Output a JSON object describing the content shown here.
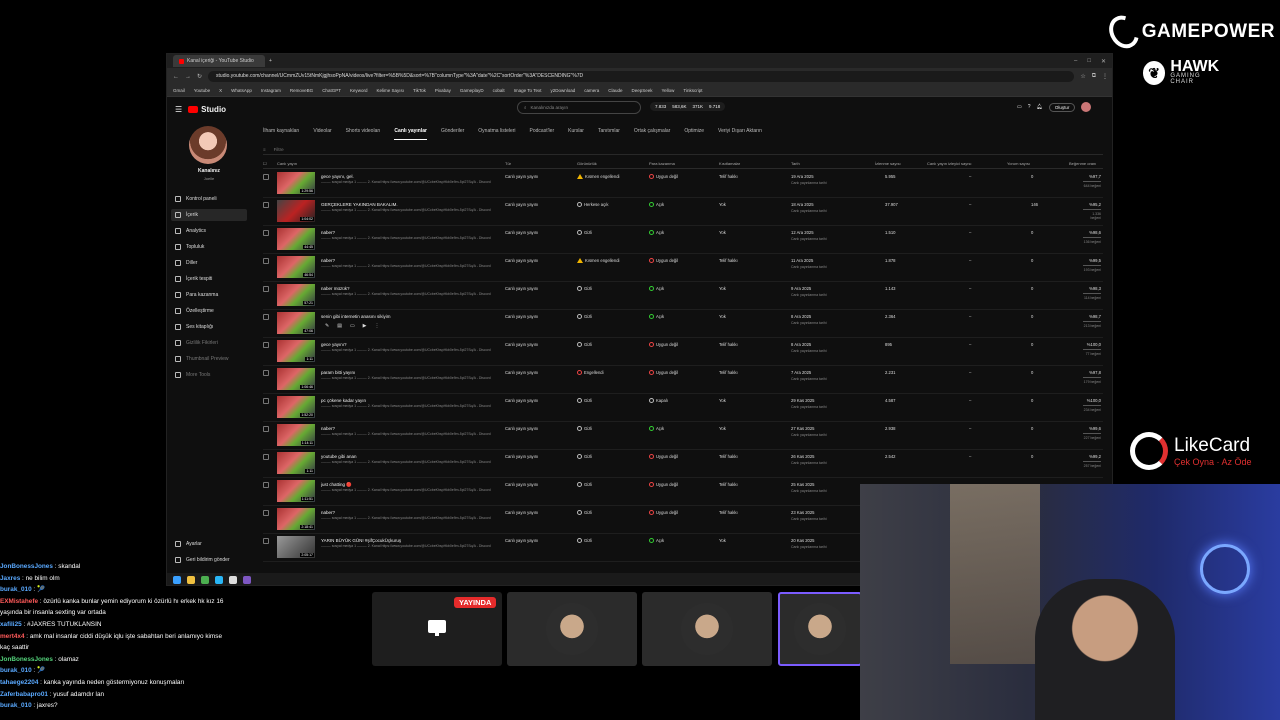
{
  "overlay": {
    "gamepower": "GAMEPOWER",
    "hawk": "HAWK",
    "hawk_sub": "GAMING CHAIR",
    "likecard": "LikeCard",
    "likecard_sub": "Çek Oyna · Az Öde"
  },
  "browser": {
    "tab_title": "Kanal içeriği - YouTube Studio",
    "url": "studio.youtube.com/channel/UCmmZUv15tNmKjgjhsoPpNA/videos/live?filter=%5B%5D&sort=%7B\"columnType\"%3A\"date\"%2C\"sortOrder\"%3A\"DESCENDING\"%7D",
    "bookmarks": [
      "Gmail",
      "Youtube",
      "X",
      "WhatsApp",
      "Instagram",
      "RemoveBG",
      "ChatGPT",
      "Keyword",
      "Kelime Sayısı",
      "TikTok",
      "Pixabay",
      "GameplayD",
      "cobalt",
      "Image To Text",
      "y2Download",
      "camera",
      "Claude",
      "DeepSeek",
      "Yellow",
      "Tinkscript"
    ]
  },
  "header": {
    "logo": "Studio",
    "search_placeholder": "Kanalınızda arayın",
    "stats": [
      "7.833",
      "583,6K",
      "371K",
      "9.718"
    ],
    "create": "Oluştur"
  },
  "sidebar": {
    "channel_name": "Kanalınız",
    "channel_sub": "Joelle",
    "items": [
      "Kontrol paneli",
      "İçerik",
      "Analytics",
      "Topluluk",
      "Diller",
      "İçerik tespiti",
      "Para kazanma",
      "Özelleştirme",
      "Ses kitaplığı",
      "Gizlilik Fikirleri",
      "Thumbnail Preview",
      "More Tools"
    ],
    "bottom": [
      "Ayarlar",
      "Geri bildirim gönder"
    ]
  },
  "tabs": [
    "İlham kaynakları",
    "Videolar",
    "Shorts videoları",
    "Canlı yayınlar",
    "Gönderiler",
    "Oynatma listeleri",
    "Podcast'ler",
    "Kurslar",
    "Tanıtımlar",
    "Ortak çalışmalar",
    "Optimize",
    "Veriyi Dışarı Aktarın"
  ],
  "filter_label": "Filtre",
  "columns": [
    "Canlı yayın",
    "Tür",
    "Görünürlük",
    "Para kazanma",
    "Kısıtlamalar",
    "Tarih",
    "İzlenme sayısı",
    "Canlı yayın izleyici sayısı",
    "Yorum sayısı",
    "Beğenme oranı"
  ],
  "rows": [
    {
      "title": "gece yayını, gel.",
      "dur": "1:29:56",
      "type": "Canlı yayın yayını",
      "vis": "Kısmen engellendi",
      "vis_icon": "warn",
      "money": "Uygun değil",
      "money_icon": "red",
      "restr": "Telif hakkı",
      "date": "19 Ara 2025",
      "date_sub": "Canlı yayınlanma tarihi",
      "views": "5.955",
      "live": "–",
      "comments": "0",
      "pct": "%97,7",
      "likes": "644 beğeni"
    },
    {
      "title": "GERÇEKLERE YAKINDAN BAKALIM.",
      "dur": "1:04:02",
      "type": "Canlı yayın yayını",
      "vis": "Herkese açık",
      "vis_icon": "dot",
      "money": "Açık",
      "money_icon": "green",
      "restr": "Yok",
      "date": "18 Ara 2025",
      "date_sub": "Canlı yayınlanma tarihi",
      "views": "37.907",
      "live": "–",
      "comments": "146",
      "pct": "%95,2",
      "likes": "1.336 beğeni"
    },
    {
      "title": "naber?",
      "dur": "44:45",
      "type": "Canlı yayın yayını",
      "vis": "Gizli",
      "vis_icon": "dot",
      "money": "Açık",
      "money_icon": "green",
      "restr": "Yok",
      "date": "12 Ara 2025",
      "date_sub": "Canlı yayınlanma tarihi",
      "views": "1.510",
      "live": "–",
      "comments": "0",
      "pct": "%98,6",
      "likes": "136 beğeni"
    },
    {
      "title": "naber?",
      "dur": "46:54",
      "type": "Canlı yayın yayını",
      "vis": "Kısmen engellendi",
      "vis_icon": "warn",
      "money": "Uygun değil",
      "money_icon": "red",
      "restr": "Telif hakkı",
      "date": "11 Ara 2025",
      "date_sub": "Canlı yayınlanma tarihi",
      "views": "1.878",
      "live": "–",
      "comments": "0",
      "pct": "%99,5",
      "likes": "193 beğeni"
    },
    {
      "title": "naber müzük?",
      "dur": "57:21",
      "type": "Canlı yayın yayını",
      "vis": "Gizli",
      "vis_icon": "dot",
      "money": "Açık",
      "money_icon": "green",
      "restr": "Yok",
      "date": "9 Ara 2025",
      "date_sub": "Canlı yayınlanma tarihi",
      "views": "1.143",
      "live": "–",
      "comments": "0",
      "pct": "%98,3",
      "likes": "114 beğeni"
    },
    {
      "title": "senin gibi internetin anasını sikiyim",
      "dur": "47:06",
      "type": "Canlı yayın yayını",
      "vis": "Gizli",
      "vis_icon": "dot",
      "money": "Açık",
      "money_icon": "green",
      "restr": "Yok",
      "date": "8 Ara 2025",
      "date_sub": "Canlı yayınlanma tarihi",
      "views": "2.364",
      "live": "–",
      "comments": "0",
      "pct": "%98,7",
      "likes": "213 beğeni"
    },
    {
      "title": "gece yayını?",
      "dur": "1:11",
      "type": "Canlı yayın yayını",
      "vis": "Gizli",
      "vis_icon": "dot",
      "money": "Uygun değil",
      "money_icon": "red",
      "restr": "Telif hakkı",
      "date": "8 Ara 2025",
      "date_sub": "Canlı yayınlanma tarihi",
      "views": "895",
      "live": "–",
      "comments": "0",
      "pct": "%100,0",
      "likes": "77 beğeni"
    },
    {
      "title": "param bitti yayını",
      "dur": "1:06:46",
      "type": "Canlı yayın yayını",
      "vis": "Engellendi",
      "vis_icon": "red",
      "money": "Uygun değil",
      "money_icon": "red",
      "restr": "Telif hakkı",
      "date": "7 Ara 2025",
      "date_sub": "Canlı yayınlanma tarihi",
      "views": "2.231",
      "live": "–",
      "comments": "0",
      "pct": "%97,8",
      "likes": "179 beğeni"
    },
    {
      "title": "pc çökene kadar yayın",
      "dur": "1:52:20",
      "type": "Canlı yayın yayını",
      "vis": "Gizli",
      "vis_icon": "dot",
      "money": "Kapalı",
      "money_icon": "dot",
      "restr": "Yok",
      "date": "29 Kas 2025",
      "date_sub": "Canlı yayınlanma tarihi",
      "views": "4.587",
      "live": "–",
      "comments": "0",
      "pct": "%100,0",
      "likes": "234 beğeni"
    },
    {
      "title": "naber?",
      "dur": "1:14:11",
      "type": "Canlı yayın yayını",
      "vis": "Gizli",
      "vis_icon": "dot",
      "money": "Açık",
      "money_icon": "green",
      "restr": "Yok",
      "date": "27 Kas 2025",
      "date_sub": "Canlı yayınlanma tarihi",
      "views": "2.938",
      "live": "–",
      "comments": "0",
      "pct": "%99,6",
      "likes": "227 beğeni"
    },
    {
      "title": "youtube gibi anan",
      "dur": "1:11",
      "type": "Canlı yayın yayını",
      "vis": "Gizli",
      "vis_icon": "dot",
      "money": "Uygun değil",
      "money_icon": "red",
      "restr": "Telif hakkı",
      "date": "26 Kas 2025",
      "date_sub": "Canlı yayınlanma tarihi",
      "views": "2.542",
      "live": "–",
      "comments": "0",
      "pct": "%99,2",
      "likes": "257 beğeni"
    },
    {
      "title": "just chatting 🔴",
      "dur": "1:11:51",
      "type": "Canlı yayın yayını",
      "vis": "Gizli",
      "vis_icon": "dot",
      "money": "Uygun değil",
      "money_icon": "red",
      "restr": "Telif hakkı",
      "date": "25 Kas 2025",
      "date_sub": "Canlı yayınlanma tarihi",
      "views": "",
      "live": "",
      "comments": "",
      "pct": "",
      "likes": ""
    },
    {
      "title": "naber?",
      "dur": "2:18:41",
      "type": "Canlı yayın yayını",
      "vis": "Gizli",
      "vis_icon": "dot",
      "money": "Uygun değil",
      "money_icon": "red",
      "restr": "Telif hakkı",
      "date": "23 Kas 2025",
      "date_sub": "Canlı yayınlanma tarihi",
      "views": "",
      "live": "",
      "comments": "",
      "pct": "",
      "likes": ""
    },
    {
      "title": "YARIN BÜYÜK GÜN! #şifÇocukÜçkuruş",
      "dur": "2:05:17",
      "type": "Canlı yayın yayını",
      "vis": "Gizli",
      "vis_icon": "dot",
      "money": "Açık",
      "money_icon": "green",
      "restr": "Yok",
      "date": "20 Kas 2025",
      "date_sub": "Canlı yayınlanma tarihi",
      "views": "",
      "live": "",
      "comments": "",
      "pct": "",
      "likes": ""
    }
  ],
  "row_desc": "––––– sosyal medya 1 ––––– 2. Kanal https://www.youtube.com/@UCcbeKhspHkb0e9m-5pl27Sq/A - Discord",
  "chat": [
    {
      "user": "JonBonessJones",
      "color": "blue",
      "text": "skandal"
    },
    {
      "user": "Jaxres",
      "color": "blue",
      "text": "ne bilim olm"
    },
    {
      "user": "burak_010",
      "color": "blue",
      "text": "🎾"
    },
    {
      "user": "EXMistahefe",
      "color": "red",
      "text": "özürlü kanka bunlar yemin ediyorum ki özürlü hı erkek hk kız 16"
    },
    {
      "user": "",
      "color": "blue",
      "text": "yaşında bir insanla sexting var ortada"
    },
    {
      "user": "xafili25",
      "color": "blue",
      "text": "#JAXRES TUTUKLANSIN"
    },
    {
      "user": "mert4x4",
      "color": "red",
      "text": "amk mal insanlar ciddi düşük iqlu işte sabahtan beri anlamıyo kimse"
    },
    {
      "user": "",
      "color": "blue",
      "text": "kaç saattir"
    },
    {
      "user": "JonBonessJones",
      "color": "green",
      "text": "olamaz"
    },
    {
      "user": "burak_010",
      "color": "blue",
      "text": "🎾"
    },
    {
      "user": "tahaege2204",
      "color": "blue",
      "text": "kanka yayında neden göstermiyonuz konuşmaları"
    },
    {
      "user": "Zaferbabapro01",
      "color": "blue",
      "text": "yusuf adamdır lan"
    },
    {
      "user": "burak_010",
      "color": "blue",
      "text": "jaxres?"
    }
  ],
  "live_badge": "YAYINDA"
}
